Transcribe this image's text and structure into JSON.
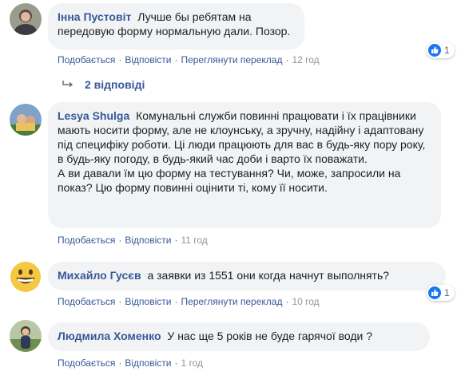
{
  "comments": [
    {
      "author": "Інна Пустовіт",
      "text": "Лучше бы ребятам на передовую форму нормальную дали. Позор.",
      "actions": {
        "like": "Подобається",
        "reply": "Відповісти",
        "translate": "Переглянути переклад"
      },
      "time": "12 год",
      "reactions": "1",
      "avatar_icon": "user-photo-icon"
    },
    {
      "author": "Lesya Shulga",
      "text": "Комунальні служби повинні працювати і їх працівники мають носити форму, але не клоунську, а зручну, надійну і адаптовану під специфіку роботи. Ці люди працюють для вас в будь-яку пору року, в будь-яку погоду, в будь-який час доби і варто їх поважати.",
      "text2": "А ви давали їм цю форму на тестування? Чи, може, запросили на показ? Цю форму повинні оцінити ті, кому її носити.",
      "actions": {
        "like": "Подобається",
        "reply": "Відповісти"
      },
      "time": "11 год",
      "avatar_icon": "user-photo-icon"
    },
    {
      "author": "Михайло Гусєв",
      "text": "а заявки из 1551 они когда начнут выполнять?",
      "actions": {
        "like": "Подобається",
        "reply": "Відповісти",
        "translate": "Переглянути переклад"
      },
      "time": "10 год",
      "reactions": "1",
      "avatar_icon": "smiley-emoji-icon"
    },
    {
      "author": "Людмила Хоменко",
      "text": "У нас ще 5 років не буде гарячої води ?",
      "actions": {
        "like": "Подобається",
        "reply": "Відповісти"
      },
      "time": "1 год",
      "avatar_icon": "user-photo-icon"
    }
  ],
  "replies_link": "2 відповіді",
  "colors": {
    "link": "#385898",
    "bubble": "#f2f3f5",
    "like_blue": "#1877f2",
    "meta_gray": "#606770"
  }
}
